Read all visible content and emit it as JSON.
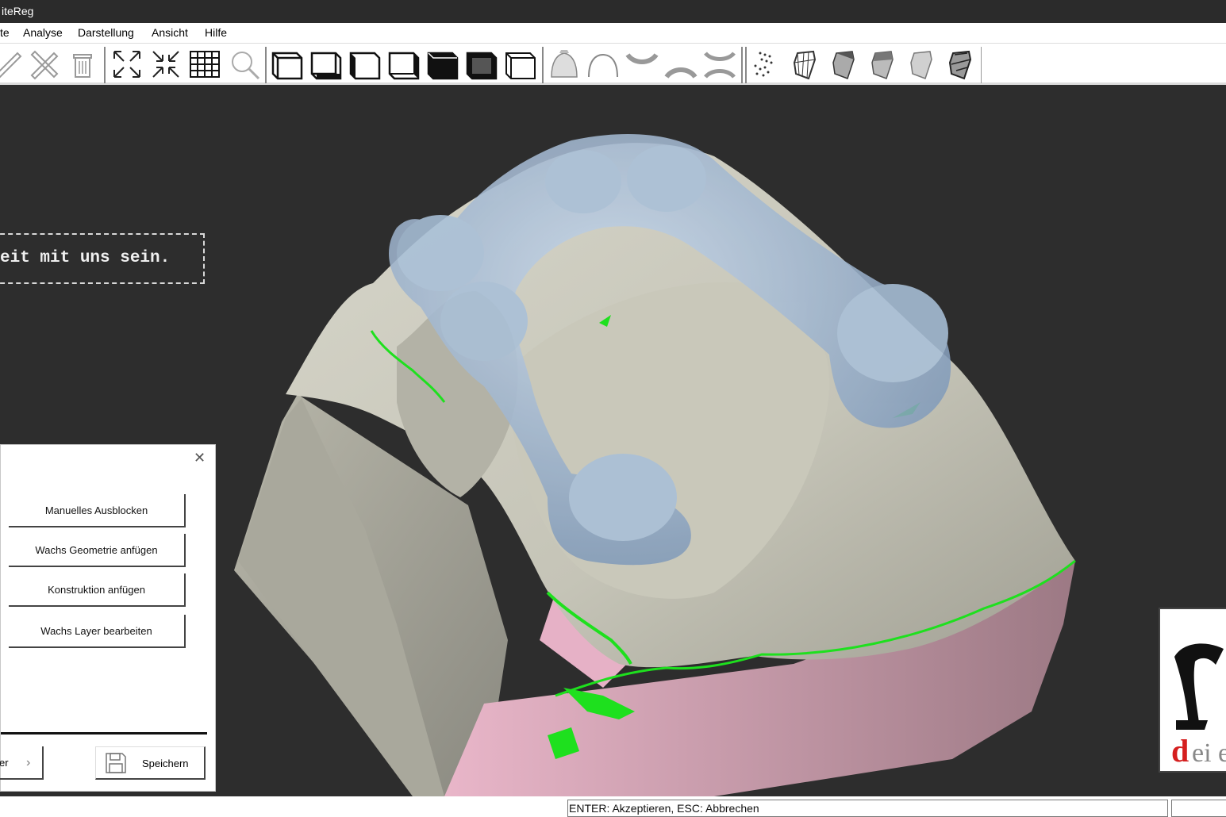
{
  "window": {
    "title": "iteReg"
  },
  "menu": [
    "te",
    "Analyse",
    "Darstellung",
    "Ansicht",
    "Hilfe"
  ],
  "toolbar_icons": [
    "ruler-icon",
    "measure-cross-icon",
    "trash-icon",
    "expand-icon",
    "collapse-icon",
    "grid-icon",
    "zoom-icon",
    "view-front-icon",
    "view-back-icon",
    "view-left-icon",
    "view-right-icon",
    "view-top-icon",
    "view-bottom-icon",
    "view-iso-icon",
    "gingiva-mask-icon",
    "gingiva-outline-icon",
    "upper-jaw-icon",
    "lower-jaw-icon",
    "both-jaws-icon",
    "point-cloud-icon",
    "model-wire-icon",
    "model-shade-1-icon",
    "model-shade-2-icon",
    "model-shade-3-icon",
    "model-shade-4-icon"
  ],
  "viewport": {
    "banner_text": "eit mit uns sein.",
    "logo_text": "dei e"
  },
  "panel": {
    "buttons": [
      "Manuelles Ausblocken",
      "Wachs Geometrie anfügen",
      "Konstruktion anfügen",
      "Wachs Layer bearbeiten"
    ],
    "next_label": "er",
    "save_label": "Speichern"
  },
  "status": {
    "text": "ENTER: Akzeptieren, ESC: Abbrechen"
  },
  "colors": {
    "model": "#c9c8bb",
    "gingiva": "#e8aac4",
    "scaffold": "#9bb4cf",
    "margin": "#1ee01e",
    "viewport_bg": "#2d2d2d"
  }
}
